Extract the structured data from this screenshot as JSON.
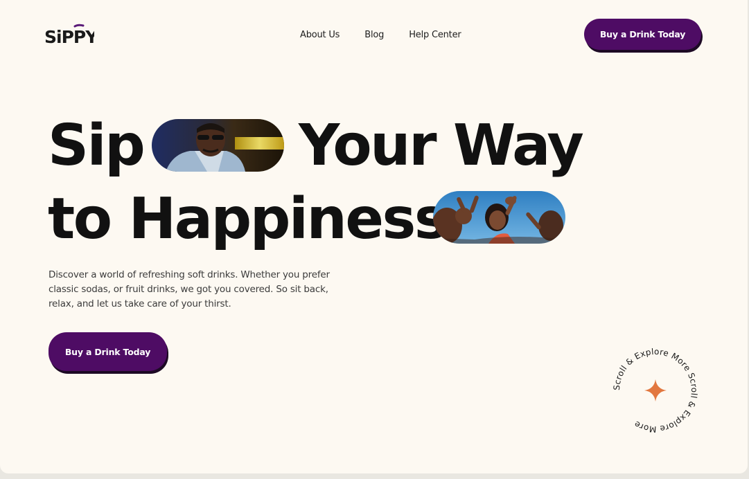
{
  "header": {
    "logo_text": "SiPPY",
    "nav": [
      {
        "label": "About Us"
      },
      {
        "label": "Blog"
      },
      {
        "label": "Help Center"
      }
    ],
    "cta_label": "Buy a Drink Today"
  },
  "hero": {
    "line1_word1": "Sip",
    "line1_word2": "Your Way",
    "line2_word1": "to Happiness",
    "description": "Discover a world of refreshing soft drinks. Whether you prefer classic sodas, or fruit drinks, we got you covered. So sit back, relax, and let us take care of your thirst.",
    "cta_label": "Buy a Drink Today"
  },
  "scroll_badge": {
    "text": "Scroll & Explore More Scroll & Explore More",
    "icon": "sparkle-icon"
  },
  "colors": {
    "background": "#fdf9f2",
    "brand_purple": "#4e0c64",
    "text_dark": "#111111",
    "accent_orange": "#e2773f"
  }
}
